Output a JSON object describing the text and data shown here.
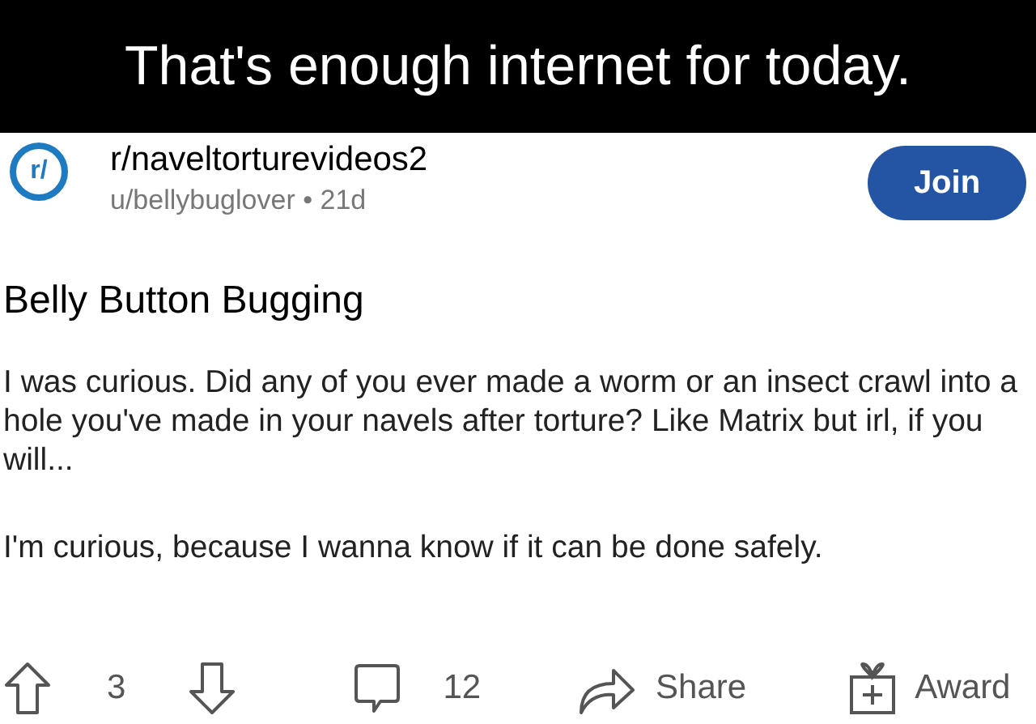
{
  "caption": "That's enough internet for today.",
  "post": {
    "subreddit": "r/naveltorturevideos2",
    "icon_text": "r/",
    "meta": "u/bellybuglover • 21d",
    "join": "Join",
    "title": "Belly Button Bugging",
    "paragraphs": [
      "I was curious. Did any of you ever made a worm or an insect crawl into a hole you've made in your navels after torture? Like Matrix but irl, if you will...",
      "I'm curious, because I wanna know if it can be done safely."
    ]
  },
  "actions": {
    "votes": "3",
    "comments": "12",
    "share": "Share",
    "award": "Award"
  }
}
